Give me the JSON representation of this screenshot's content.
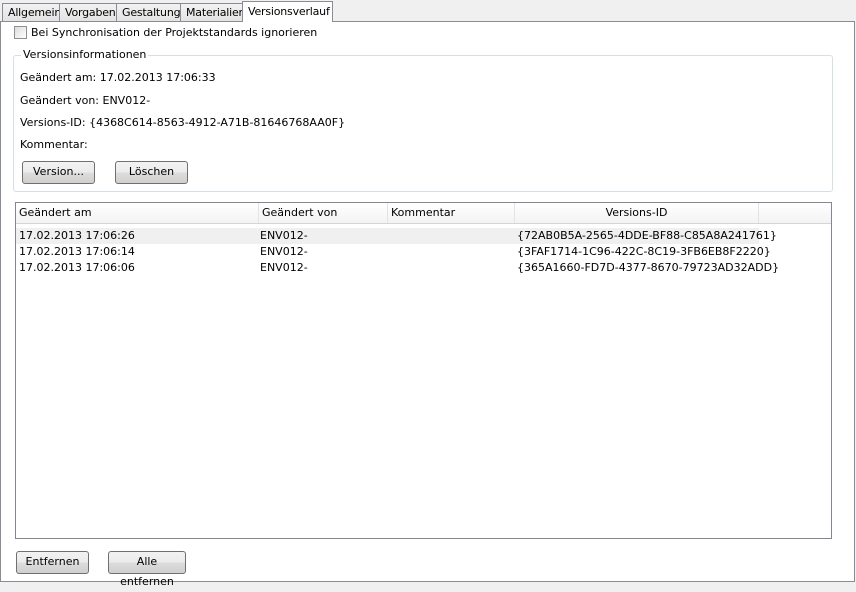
{
  "tabs": [
    {
      "label": "Allgemein",
      "active": false
    },
    {
      "label": "Vorgaben",
      "active": false
    },
    {
      "label": "Gestaltung",
      "active": false
    },
    {
      "label": "Materialien",
      "active": false
    },
    {
      "label": "Versionsverlauf",
      "active": true
    }
  ],
  "sync_checkbox": {
    "label": "Bei Synchronisation der Projektstandards ignorieren",
    "checked": false
  },
  "version_info": {
    "title": "Versionsinformationen",
    "changed_at": "Geändert am: 17.02.2013 17:06:33",
    "changed_by": "Geändert von: ENV012-",
    "version_id": "Versions-ID: {4368C614-8563-4912-A71B-81646768AA0F}",
    "comment": "Kommentar:"
  },
  "buttons": {
    "version": "Version...",
    "delete": "Löschen",
    "remove": "Entfernen",
    "remove_all": "Alle entfernen"
  },
  "history": {
    "columns": [
      "Geändert am",
      "Geändert von",
      "Kommentar",
      "Versions-ID"
    ],
    "rows": [
      {
        "date": "17.02.2013 17:06:26",
        "user": "ENV012-",
        "comment": "",
        "id": "{72AB0B5A-2565-4DDE-BF88-C85A8A241761}"
      },
      {
        "date": "17.02.2013 17:06:14",
        "user": "ENV012-",
        "comment": "",
        "id": "{3FAF1714-1C96-422C-8C19-3FB6EB8F2220}"
      },
      {
        "date": "17.02.2013 17:06:06",
        "user": "ENV012-",
        "comment": "",
        "id": "{365A1660-FD7D-4377-8670-79723AD32ADD}"
      }
    ]
  }
}
